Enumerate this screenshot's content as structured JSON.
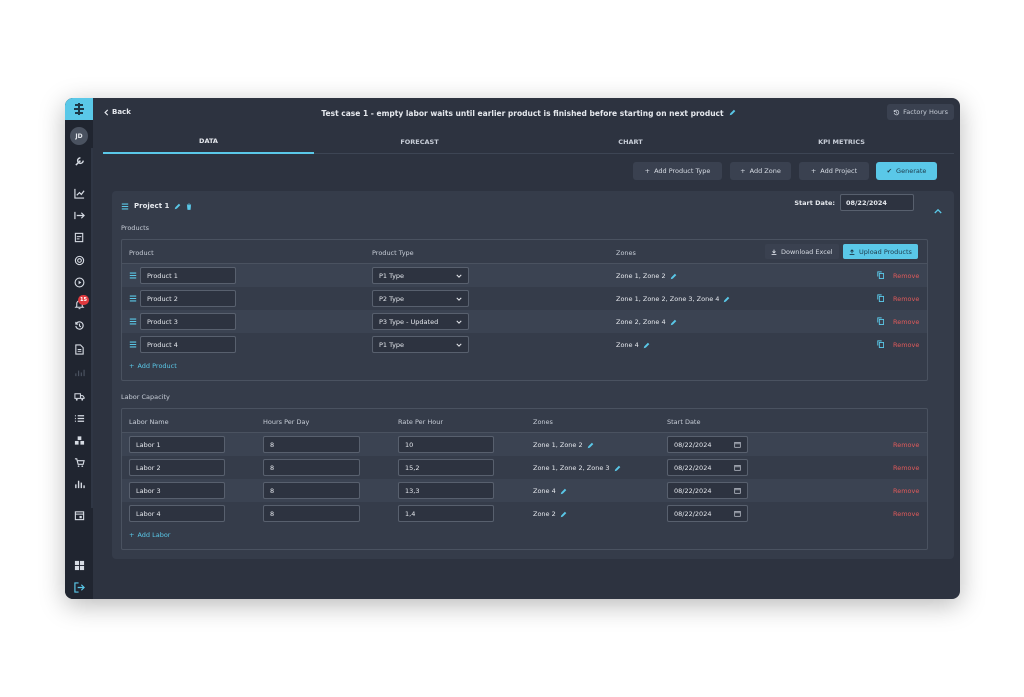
{
  "header": {
    "back_label": "Back",
    "title": "Test case 1 - empty labor waits until earlier product is finished before starting on next product",
    "factory_hours_label": "Factory Hours"
  },
  "sidebar": {
    "avatar_initials": "JD",
    "notification_count": "15"
  },
  "tabs": [
    {
      "label": "DATA",
      "active": true
    },
    {
      "label": "FORECAST",
      "active": false
    },
    {
      "label": "CHART",
      "active": false
    },
    {
      "label": "KPI METRICS",
      "active": false
    }
  ],
  "actions": {
    "add_product_type": "Add Product Type",
    "add_zone": "Add Zone",
    "add_project": "Add Project",
    "generate": "Generate"
  },
  "project": {
    "name": "Project 1",
    "start_date_label": "Start Date:",
    "start_date": "08/22/2024"
  },
  "products": {
    "section_label": "Products",
    "columns": {
      "product": "Product",
      "product_type": "Product Type",
      "zones": "Zones"
    },
    "download_label": "Download Excel",
    "upload_label": "Upload Products",
    "rows": [
      {
        "name": "Product 1",
        "type": "P1 Type",
        "zones": "Zone 1, Zone 2",
        "remove": "Remove"
      },
      {
        "name": "Product 2",
        "type": "P2 Type",
        "zones": "Zone 1, Zone 2, Zone 3, Zone 4",
        "remove": "Remove"
      },
      {
        "name": "Product 3",
        "type": "P3 Type - Updated",
        "zones": "Zone 2, Zone 4",
        "remove": "Remove"
      },
      {
        "name": "Product 4",
        "type": "P1 Type",
        "zones": "Zone 4",
        "remove": "Remove"
      }
    ],
    "add_label": "Add Product"
  },
  "labor": {
    "section_label": "Labor Capacity",
    "columns": {
      "name": "Labor Name",
      "hours": "Hours Per Day",
      "rate": "Rate Per Hour",
      "zones": "Zones",
      "start_date": "Start Date"
    },
    "rows": [
      {
        "name": "Labor 1",
        "hours": "8",
        "rate": "10",
        "zones": "Zone 1, Zone 2",
        "start_date": "08/22/2024",
        "remove": "Remove"
      },
      {
        "name": "Labor 2",
        "hours": "8",
        "rate": "15,2",
        "zones": "Zone 1, Zone 2, Zone 3",
        "start_date": "08/22/2024",
        "remove": "Remove"
      },
      {
        "name": "Labor 3",
        "hours": "8",
        "rate": "13,3",
        "zones": "Zone 4",
        "start_date": "08/22/2024",
        "remove": "Remove"
      },
      {
        "name": "Labor 4",
        "hours": "8",
        "rate": "1,4",
        "zones": "Zone 2",
        "start_date": "08/22/2024",
        "remove": "Remove"
      }
    ],
    "add_label": "Add Labor"
  },
  "colors": {
    "accent": "#5ac8e8",
    "danger": "#e05a5a",
    "background": "#2d3340",
    "sidebar": "#202530"
  }
}
